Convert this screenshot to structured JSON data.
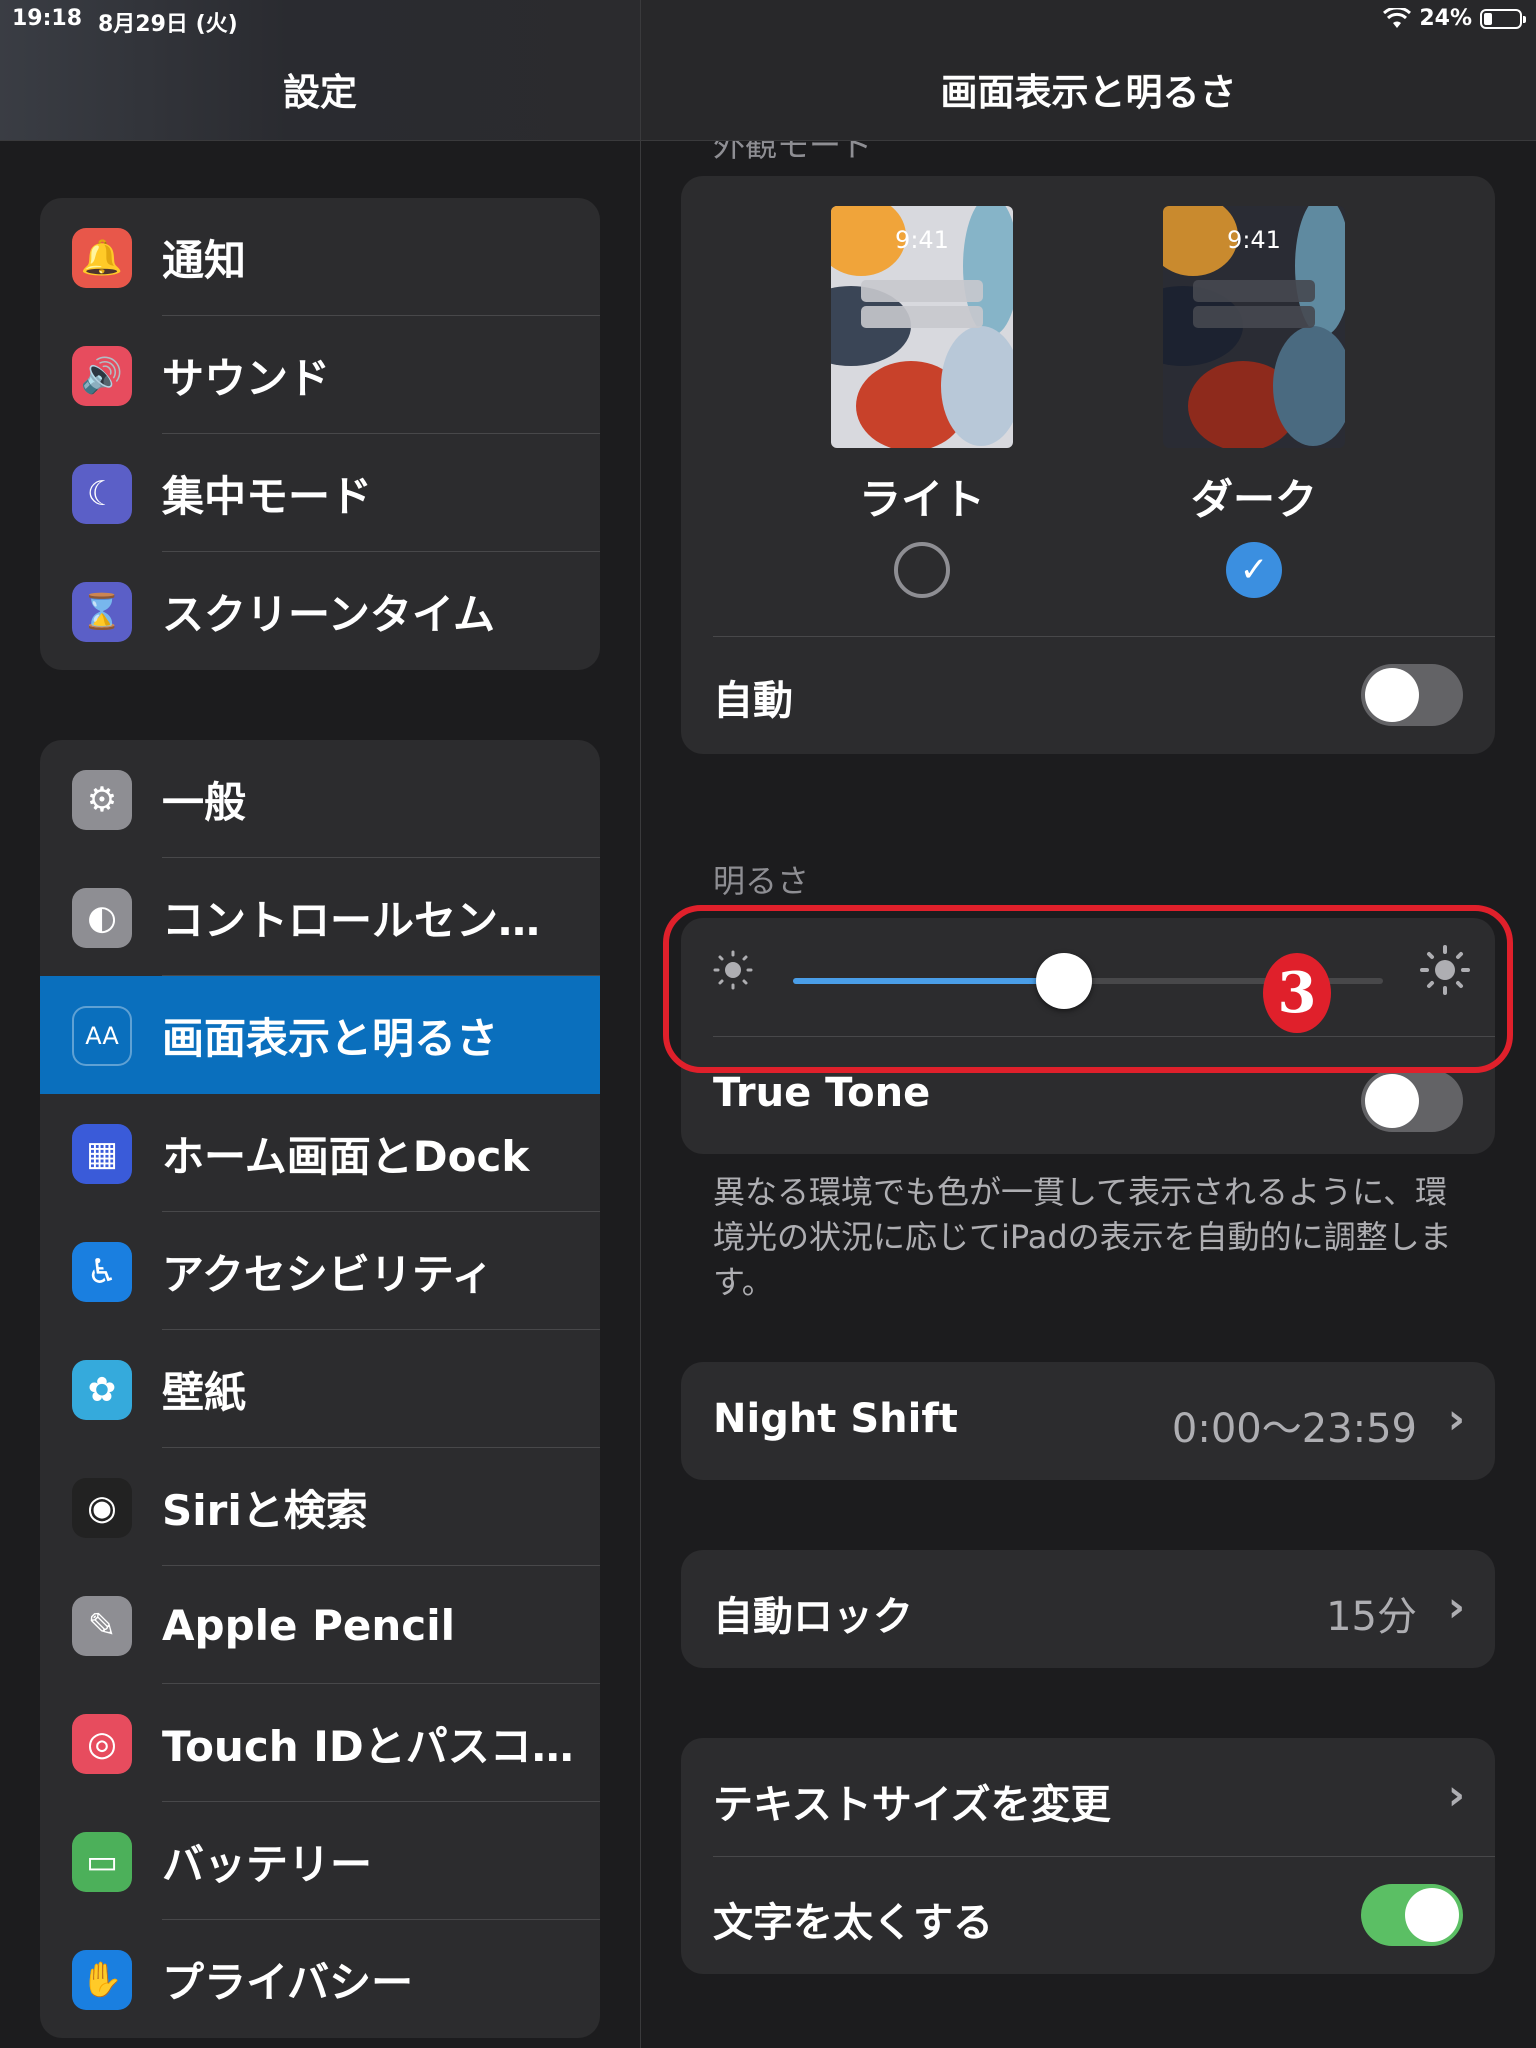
{
  "status_bar": {
    "time": "19:18",
    "date": "8月29日 (火)",
    "battery": "24%",
    "battery_level": 0.24
  },
  "sidebar": {
    "title": "設定",
    "groups": [
      [
        {
          "label": "通知",
          "icon": "bell-icon",
          "color": "#e8574a"
        },
        {
          "label": "サウンド",
          "icon": "speaker-icon",
          "color": "#e74c5e"
        },
        {
          "label": "集中モード",
          "icon": "moon-icon",
          "color": "#5b5fc7"
        },
        {
          "label": "スクリーンタイム",
          "icon": "hourglass-icon",
          "color": "#5b5fc7"
        }
      ],
      [
        {
          "label": "一般",
          "icon": "gear-icon",
          "color": "#8e8e93"
        },
        {
          "label": "コントロールセン…",
          "icon": "toggles-icon",
          "color": "#8e8e93"
        },
        {
          "label": "画面表示と明るさ",
          "icon": "text-size-icon",
          "color": "#0a6fbd",
          "selected": true
        },
        {
          "label": "ホーム画面とDock",
          "icon": "home-grid-icon",
          "color": "#3a5bd9"
        },
        {
          "label": "アクセシビリティ",
          "icon": "accessibility-icon",
          "color": "#1a7fe0"
        },
        {
          "label": "壁紙",
          "icon": "flower-icon",
          "color": "#35aadc"
        },
        {
          "label": "Siriと検索",
          "icon": "siri-icon",
          "color": "#222222"
        },
        {
          "label": "Apple Pencil",
          "icon": "pencil-icon",
          "color": "#8e8e93"
        },
        {
          "label": "Touch IDとパスコ…",
          "icon": "fingerprint-icon",
          "color": "#e74c5e"
        },
        {
          "label": "バッテリー",
          "icon": "battery-icon",
          "color": "#4cb05a"
        },
        {
          "label": "プライバシー",
          "icon": "hand-icon",
          "color": "#1a7fe0"
        }
      ]
    ]
  },
  "content": {
    "title": "画面表示と明るさ",
    "appearance": {
      "section_label": "外観モード",
      "preview_time": "9:41",
      "light_label": "ライト",
      "dark_label": "ダーク",
      "selected": "dark",
      "auto_label": "自動",
      "auto_on": false
    },
    "brightness": {
      "section_label": "明るさ",
      "level": 0.46,
      "true_tone_label": "True Tone",
      "true_tone_on": false,
      "footnote": "異なる環境でも色が一貫して表示されるように、環境光の状況に応じてiPadの表示を自動的に調整します。"
    },
    "night_shift": {
      "label": "Night Shift",
      "value": "0:00〜23:59"
    },
    "auto_lock": {
      "label": "自動ロック",
      "value": "15分"
    },
    "text_size": {
      "label": "テキストサイズを変更"
    },
    "bold_text": {
      "label": "文字を太くする",
      "on": true
    },
    "annotation": {
      "badge": "3",
      "color": "#e0202b"
    }
  }
}
